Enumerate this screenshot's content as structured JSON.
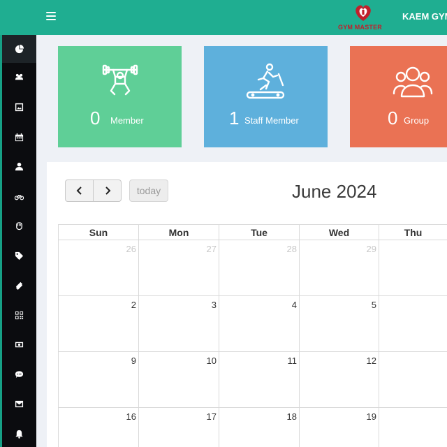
{
  "header": {
    "logo_text": "GYM MASTER",
    "gym_name": "KAEM GYM"
  },
  "sidebar": {
    "items": [
      {
        "icon": "dashboard-icon",
        "active": true
      },
      {
        "icon": "users-icon"
      },
      {
        "icon": "image-icon"
      },
      {
        "icon": "calendar-icon"
      },
      {
        "icon": "user-icon"
      },
      {
        "icon": "bicycle-icon"
      },
      {
        "icon": "hand-icon"
      },
      {
        "icon": "tags-icon"
      },
      {
        "icon": "ticket-icon"
      },
      {
        "icon": "qrcode-icon"
      },
      {
        "icon": "money-icon"
      },
      {
        "icon": "chat-icon"
      },
      {
        "icon": "mail-icon"
      },
      {
        "icon": "bell-icon"
      }
    ]
  },
  "cards": [
    {
      "count": "0",
      "label": "Member",
      "color": "#5fcf97",
      "icon": "weightlifter-icon"
    },
    {
      "count": "1",
      "label": "Staff Member",
      "color": "#5eb0dc",
      "icon": "treadmill-icon"
    },
    {
      "count": "0",
      "label": "Group",
      "color": "#ea7254",
      "icon": "group-icon"
    }
  ],
  "calendar": {
    "title": "June 2024",
    "today_label": "today",
    "weekdays": [
      "Sun",
      "Mon",
      "Tue",
      "Wed",
      "Thu"
    ],
    "weeks": [
      [
        {
          "d": "26",
          "other": true
        },
        {
          "d": "27",
          "other": true
        },
        {
          "d": "28",
          "other": true
        },
        {
          "d": "29",
          "other": true
        },
        {
          "d": "",
          "other": true
        }
      ],
      [
        {
          "d": "2"
        },
        {
          "d": "3"
        },
        {
          "d": "4"
        },
        {
          "d": "5"
        },
        {
          "d": ""
        }
      ],
      [
        {
          "d": "9"
        },
        {
          "d": "10"
        },
        {
          "d": "11"
        },
        {
          "d": "12"
        },
        {
          "d": ""
        }
      ],
      [
        {
          "d": "16"
        },
        {
          "d": "17"
        },
        {
          "d": "18"
        },
        {
          "d": "19"
        },
        {
          "d": ""
        }
      ]
    ]
  },
  "colors": {
    "topbar": "#1fae91",
    "sidebar": "#0b0c0f"
  }
}
